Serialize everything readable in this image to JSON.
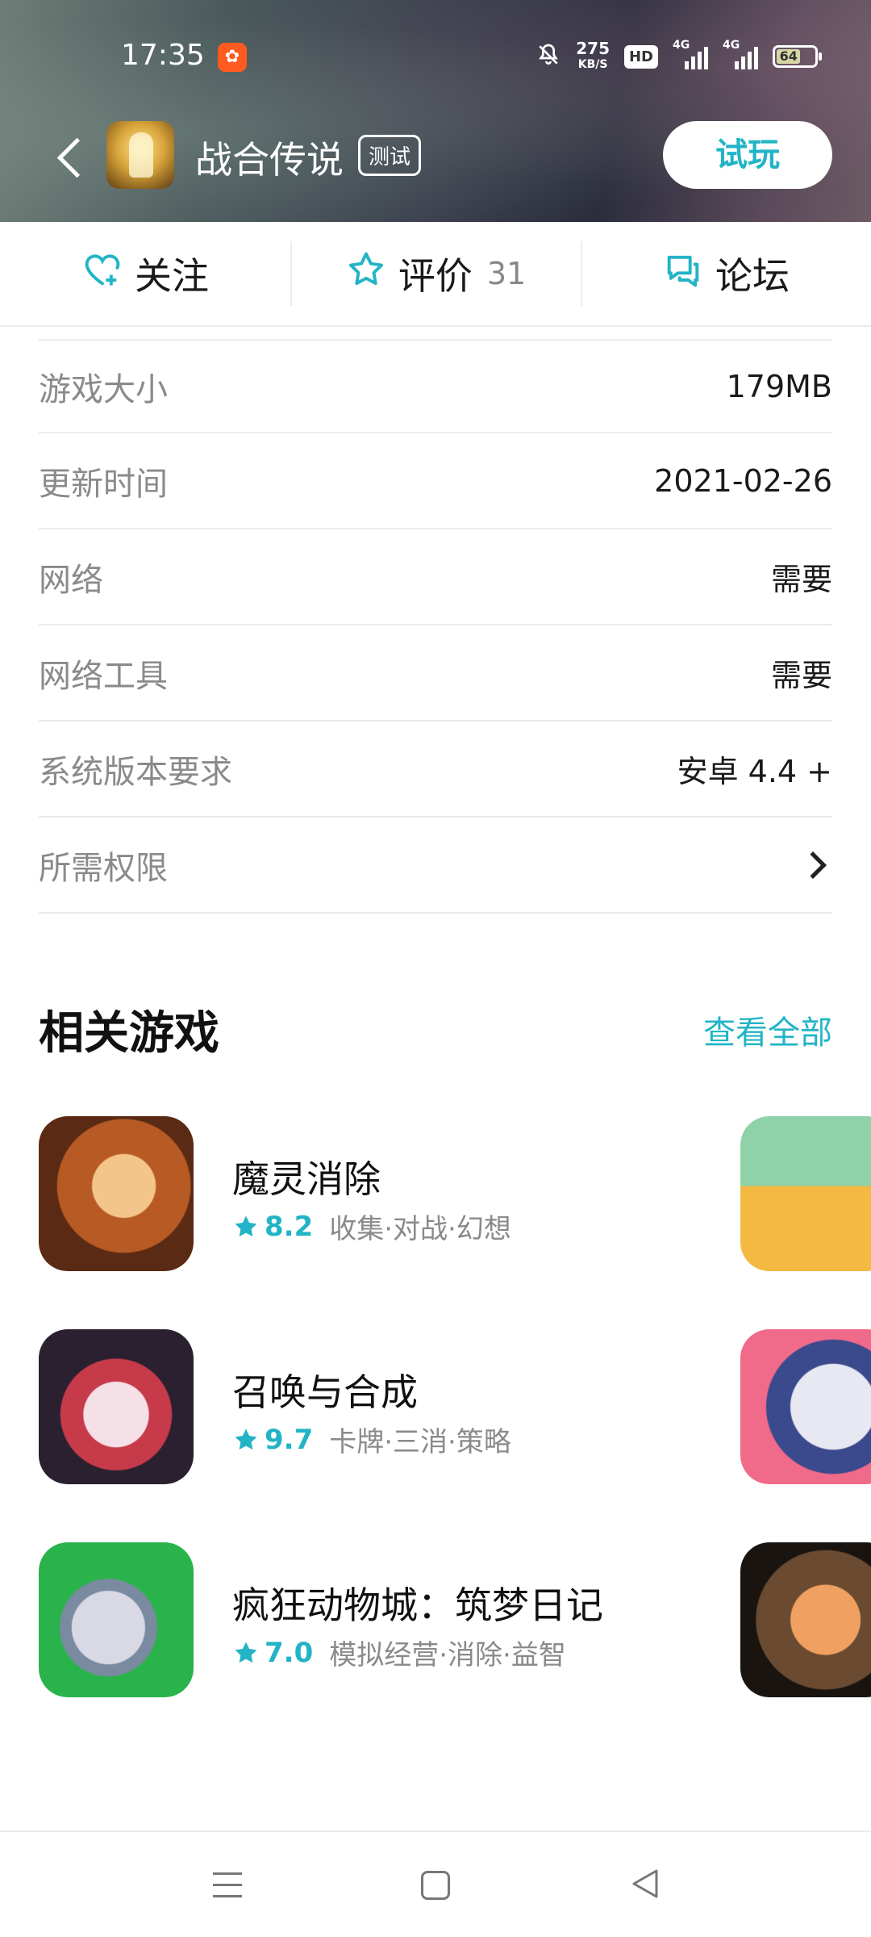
{
  "status_bar": {
    "time": "17:35",
    "net_speed_value": "275",
    "net_speed_unit": "KB/S",
    "hd_label": "HD",
    "signal1_label": "4G",
    "signal2_label": "4G",
    "battery": "64"
  },
  "app_header": {
    "title": "战合传说",
    "badge": "测试",
    "try_button": "试玩"
  },
  "tabs": [
    {
      "label": "关注",
      "icon": "heart-plus-icon"
    },
    {
      "label": "评价",
      "count": "31",
      "icon": "star-outline-icon"
    },
    {
      "label": "论坛",
      "icon": "chat-bubbles-icon"
    }
  ],
  "info": [
    {
      "label": "游戏大小",
      "value": "179MB"
    },
    {
      "label": "更新时间",
      "value": "2021-02-26"
    },
    {
      "label": "网络",
      "value": "需要"
    },
    {
      "label": "网络工具",
      "value": "需要"
    },
    {
      "label": "系统版本要求",
      "value": "安卓 4.4 +"
    },
    {
      "label": "所需权限",
      "value": ""
    }
  ],
  "related": {
    "title": "相关游戏",
    "see_all": "查看全部",
    "games": [
      {
        "name": "魔灵消除",
        "rating": "8.2",
        "tags": "收集·对战·幻想"
      },
      {
        "name": "召唤与合成",
        "rating": "9.7",
        "tags": "卡牌·三消·策略"
      },
      {
        "name": "疯狂动物城：筑梦日记",
        "rating": "7.0",
        "tags": "模拟经营·消除·益智"
      }
    ]
  },
  "colors": {
    "accent": "#22b4c6",
    "secondary_text": "#8a8a8a",
    "divider": "#ececec"
  }
}
